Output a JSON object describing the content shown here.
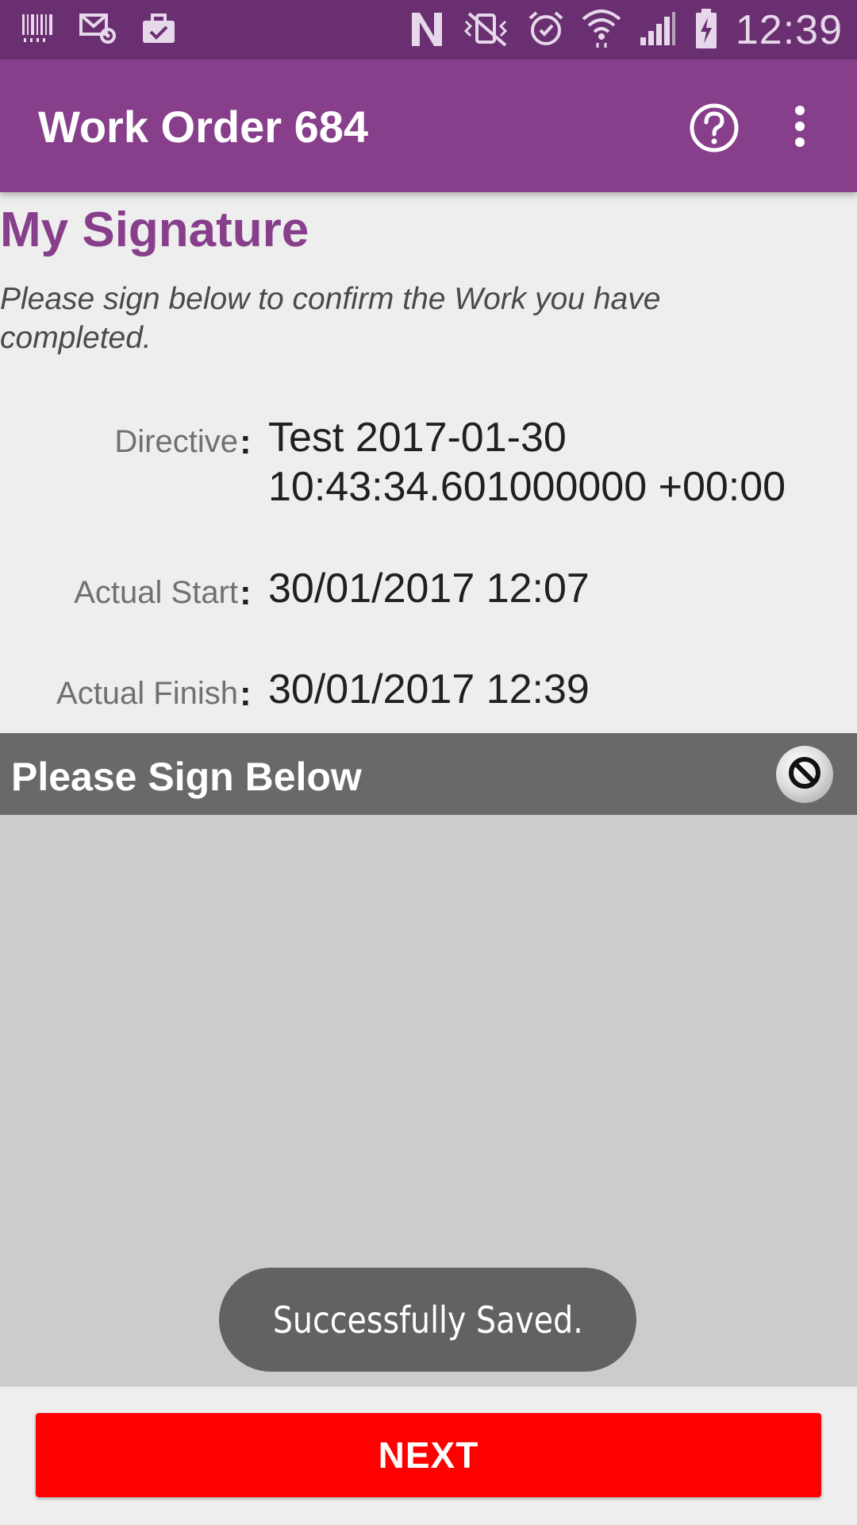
{
  "status_bar": {
    "time": "12:39",
    "left_icons": [
      "barcode-icon",
      "mail-settings-icon",
      "briefcase-check-icon"
    ],
    "right_icons": [
      "nfc-icon",
      "vibrate-mute-icon",
      "alarm-icon",
      "wifi-icon",
      "cell-signal-icon",
      "battery-charging-icon"
    ]
  },
  "app_bar": {
    "title": "Work Order 684",
    "help_icon": "help-circle-icon",
    "more_icon": "more-vert-icon"
  },
  "content": {
    "section_title": "My Signature",
    "subtitle": "Please sign below to confirm the Work you have completed.",
    "fields": [
      {
        "label": "Directive",
        "value": "Test 2017-01-30 10:43:34.601000000 +00:00"
      },
      {
        "label": "Actual Start",
        "value": "30/01/2017 12:07"
      },
      {
        "label": "Actual Finish",
        "value": "30/01/2017 12:39"
      }
    ],
    "colon": ":"
  },
  "signature_panel": {
    "title": "Please Sign Below",
    "clear_icon": "clear-signature-icon"
  },
  "toast": {
    "message": "Successfully Saved."
  },
  "footer": {
    "next_label": "NEXT"
  },
  "colors": {
    "status_bar": "#6a2f70",
    "app_bar": "#873f8c",
    "accent": "#873f8c",
    "signature_header": "#696969",
    "signature_canvas": "#cccccc",
    "next_button": "#ff0000"
  }
}
